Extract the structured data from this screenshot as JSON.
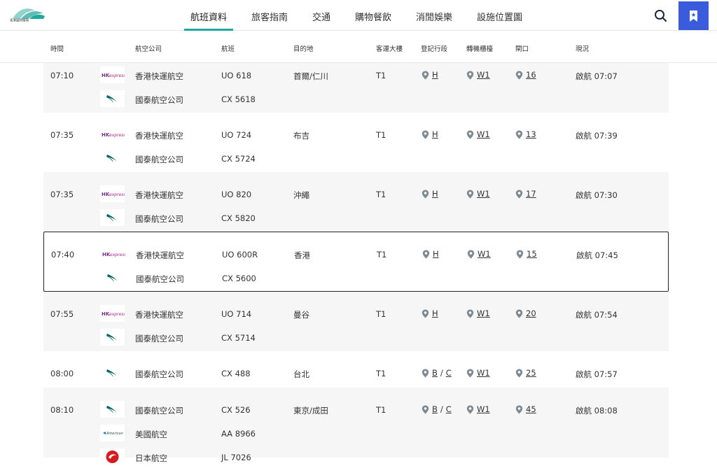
{
  "header": {
    "logo_text": "香港國際機場",
    "logo_sub": "HONG KONG INTERNATIONAL AIRPORT",
    "nav": [
      {
        "label": "航班資料",
        "active": true
      },
      {
        "label": "旅客指南",
        "active": false
      },
      {
        "label": "交通",
        "active": false
      },
      {
        "label": "購物餐飲",
        "active": false
      },
      {
        "label": "消閒娛樂",
        "active": false
      },
      {
        "label": "設施位置圖",
        "active": false
      }
    ]
  },
  "columns": {
    "time": "時間",
    "airline": "航空公司",
    "flight": "航班",
    "destination": "目的地",
    "terminal": "客運大樓",
    "checkin": "登記行段",
    "baggage": "轉機櫃檯",
    "gate": "閘口",
    "status": "現況"
  },
  "flights": [
    {
      "time": "07:10",
      "airlines": [
        {
          "name": "香港快運航空",
          "logo": "hk-express-logo",
          "flight": "UO 618"
        },
        {
          "name": "國泰航空公司",
          "logo": "cathay-logo",
          "flight": "CX 5618"
        }
      ],
      "destination": "首爾/仁川",
      "terminal": "T1",
      "checkin": [
        "H"
      ],
      "transfer": "W1",
      "gate": "16",
      "status": "啟航 07:07"
    },
    {
      "time": "07:35",
      "airlines": [
        {
          "name": "香港快運航空",
          "logo": "hk-express-logo",
          "flight": "UO 724"
        },
        {
          "name": "國泰航空公司",
          "logo": "cathay-logo",
          "flight": "CX 5724"
        }
      ],
      "destination": "布吉",
      "terminal": "T1",
      "checkin": [
        "H"
      ],
      "transfer": "W1",
      "gate": "13",
      "status": "啟航 07:39"
    },
    {
      "time": "07:35",
      "airlines": [
        {
          "name": "香港快運航空",
          "logo": "hk-express-logo",
          "flight": "UO 820"
        },
        {
          "name": "國泰航空公司",
          "logo": "cathay-logo",
          "flight": "CX 5820"
        }
      ],
      "destination": "沖繩",
      "terminal": "T1",
      "checkin": [
        "H"
      ],
      "transfer": "W1",
      "gate": "17",
      "status": "啟航 07:30"
    },
    {
      "time": "07:40",
      "airlines": [
        {
          "name": "香港快運航空",
          "logo": "hk-express-logo",
          "flight": "UO 600R"
        },
        {
          "name": "國泰航空公司",
          "logo": "cathay-logo",
          "flight": "CX 5600"
        }
      ],
      "destination": "香港",
      "terminal": "T1",
      "checkin": [
        "H"
      ],
      "transfer": "W1",
      "gate": "15",
      "status": "啟航 07:45"
    },
    {
      "time": "07:55",
      "airlines": [
        {
          "name": "香港快運航空",
          "logo": "hk-express-logo",
          "flight": "UO 714"
        },
        {
          "name": "國泰航空公司",
          "logo": "cathay-logo",
          "flight": "CX 5714"
        }
      ],
      "destination": "曼谷",
      "terminal": "T1",
      "checkin": [
        "H"
      ],
      "transfer": "W1",
      "gate": "20",
      "status": "啟航 07:54"
    },
    {
      "time": "08:00",
      "airlines": [
        {
          "name": "國泰航空公司",
          "logo": "cathay-logo",
          "flight": "CX 488"
        }
      ],
      "destination": "台北",
      "terminal": "T1",
      "checkin": [
        "B",
        "C"
      ],
      "transfer": "W1",
      "gate": "25",
      "status": "啟航 07:57"
    },
    {
      "time": "08:10",
      "airlines": [
        {
          "name": "國泰航空公司",
          "logo": "cathay-logo",
          "flight": "CX 526"
        },
        {
          "name": "美國航空",
          "logo": "american-logo",
          "flight": "AA 8966"
        },
        {
          "name": "日本航空",
          "logo": "jal-logo",
          "flight": "JL 7026"
        }
      ],
      "destination": "東京/成田",
      "terminal": "T1",
      "checkin": [
        "B",
        "C"
      ],
      "transfer": "W1",
      "gate": "45",
      "status": "啟航 08:08"
    }
  ],
  "colors": {
    "accent": "#1fa7a0",
    "bookmark_bg": "#3a5bdc",
    "hk_express": "#7a2e8c",
    "cathay": "#006564",
    "jal": "#d71920",
    "pin": "#7d8a92"
  }
}
